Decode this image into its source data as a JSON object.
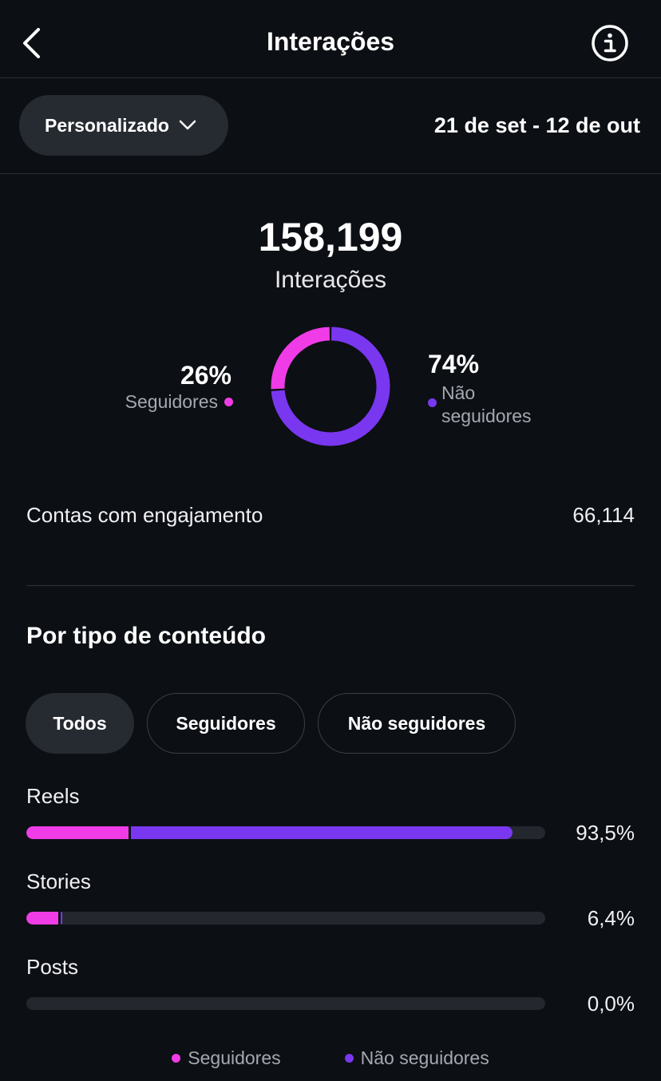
{
  "header": {
    "title": "Interações",
    "back_icon": "chevron-left-icon",
    "info_icon": "info-icon"
  },
  "filter": {
    "dropdown_label": "Personalizado",
    "dropdown_icon": "chevron-down-icon",
    "date_range": "21 de set - 12 de out"
  },
  "summary": {
    "total_value": "158,199",
    "total_label": "Interações",
    "followers_pct_text": "26%",
    "followers_label": "Seguidores",
    "nonfollowers_pct_text": "74%",
    "nonfollowers_label": "Não seguidores",
    "followers_fraction": 0.26,
    "nonfollowers_fraction": 0.74
  },
  "engaged": {
    "label": "Contas com engajamento",
    "value": "66,114"
  },
  "content_type": {
    "title": "Por tipo de conteúdo",
    "tabs": [
      {
        "label": "Todos",
        "active": true
      },
      {
        "label": "Seguidores",
        "active": false
      },
      {
        "label": "Não seguidores",
        "active": false
      }
    ],
    "rows": [
      {
        "label": "Reels",
        "pct_text": "93,5%",
        "followers_fraction": 0.197,
        "nonfollowers_fraction": 0.735
      },
      {
        "label": "Stories",
        "pct_text": "6,4%",
        "followers_fraction": 0.061,
        "nonfollowers_fraction": 0.003
      },
      {
        "label": "Posts",
        "pct_text": "0,0%",
        "followers_fraction": 0,
        "nonfollowers_fraction": 0
      }
    ]
  },
  "legend": {
    "followers": "Seguidores",
    "nonfollowers": "Não seguidores"
  },
  "colors": {
    "followers": "#f03ce6",
    "nonfollowers": "#7a37f0",
    "background": "#0c0f14"
  }
}
